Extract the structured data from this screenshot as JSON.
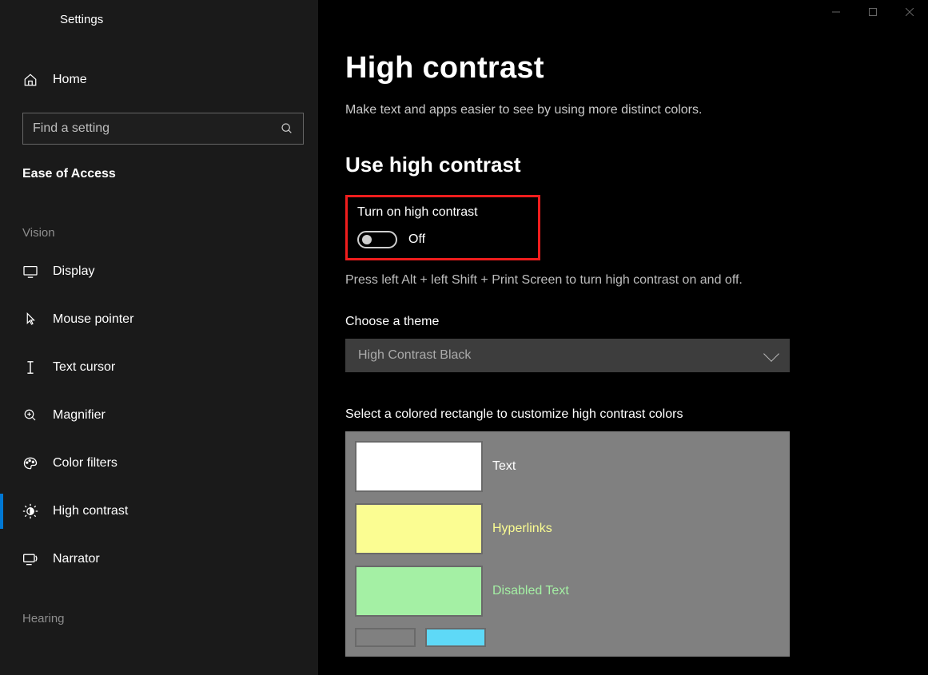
{
  "window": {
    "app_title": "Settings"
  },
  "sidebar": {
    "home_label": "Home",
    "search_placeholder": "Find a setting",
    "category_label": "Ease of Access",
    "group_vision": "Vision",
    "group_hearing": "Hearing",
    "items": [
      {
        "label": "Display"
      },
      {
        "label": "Mouse pointer"
      },
      {
        "label": "Text cursor"
      },
      {
        "label": "Magnifier"
      },
      {
        "label": "Color filters"
      },
      {
        "label": "High contrast"
      },
      {
        "label": "Narrator"
      }
    ]
  },
  "main": {
    "title": "High contrast",
    "subtitle": "Make text and apps easier to see by using more distinct colors.",
    "section_use": "Use high contrast",
    "toggle_label": "Turn on high contrast",
    "toggle_state": "Off",
    "shortcut_hint": "Press left Alt + left Shift + Print Screen to turn high contrast on and off.",
    "theme_label": "Choose a theme",
    "theme_selected": "High Contrast Black",
    "customize_label": "Select a colored rectangle to customize high contrast colors",
    "swatches": [
      {
        "label": "Text",
        "color": "#ffffff",
        "text_color": "#ffffff"
      },
      {
        "label": "Hyperlinks",
        "color": "#fbfd92",
        "text_color": "#fbfd92"
      },
      {
        "label": "Disabled Text",
        "color": "#a4f0a4",
        "text_color": "#a4f0a4"
      }
    ],
    "partial_row": {
      "left_color": "#808080",
      "right_color": "#5ed9f7"
    }
  }
}
